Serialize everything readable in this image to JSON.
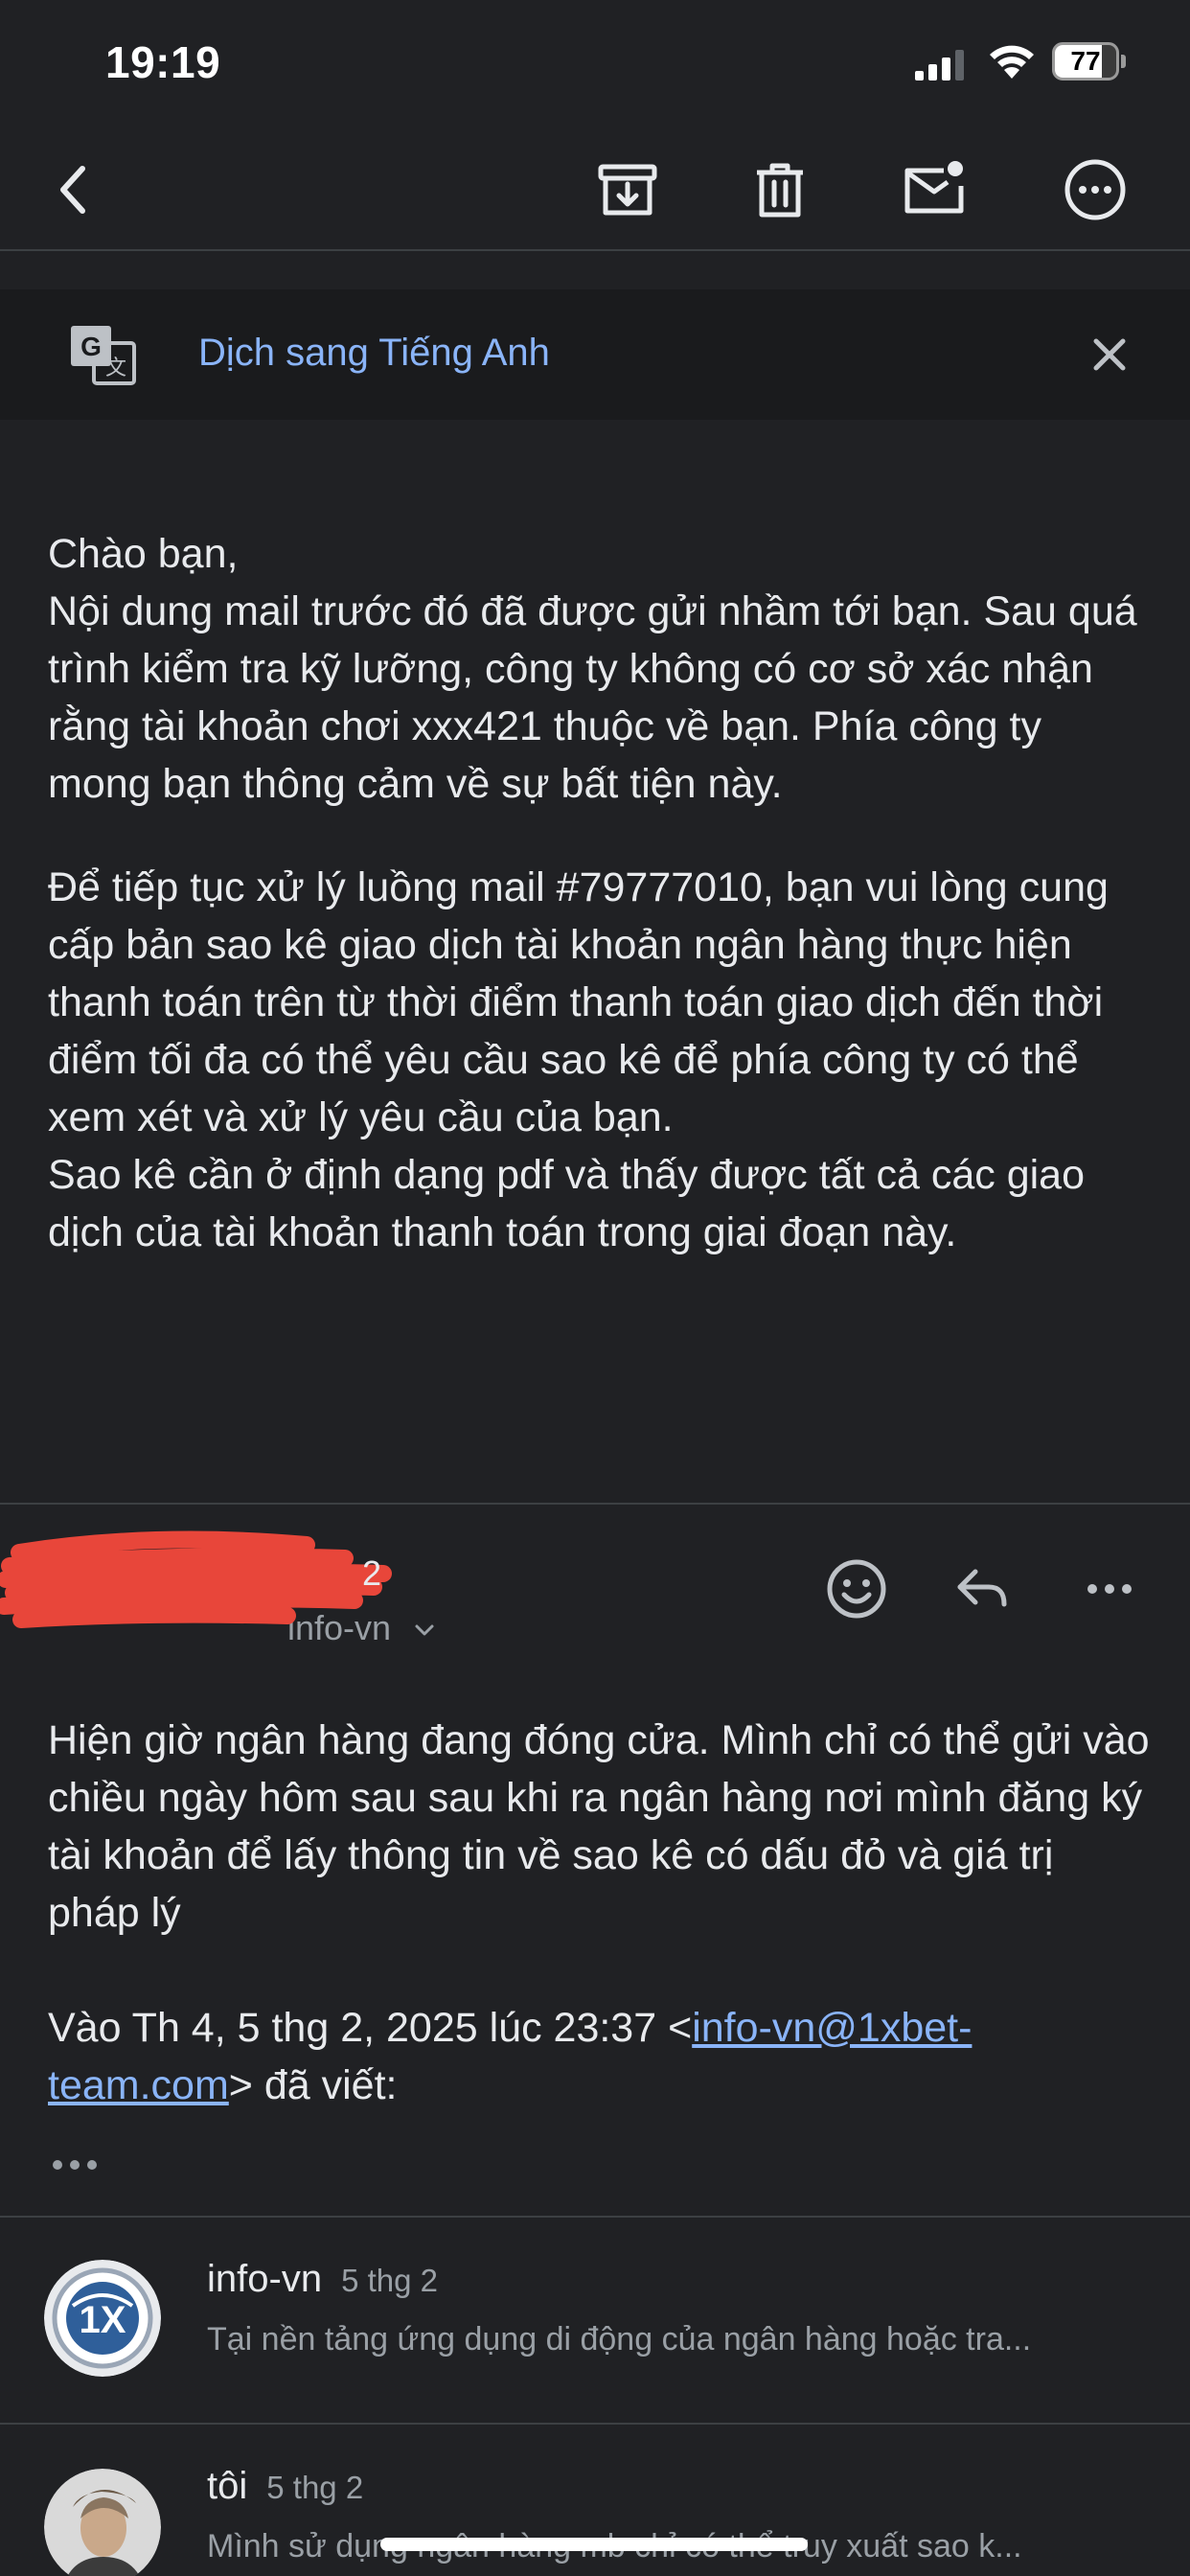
{
  "status_bar": {
    "time": "19:19",
    "battery_level": "77",
    "battery_fraction": 0.77
  },
  "toolbar": {
    "back_icon": "chevron-left-icon",
    "archive_icon": "archive-icon",
    "delete_icon": "trash-icon",
    "mark_unread_icon": "mail-unread-icon",
    "more_icon": "more-horizontal-icon"
  },
  "translate_bar": {
    "label": "Dịch sang Tiếng Anh",
    "icon": "translate-icon",
    "close_icon": "close-icon"
  },
  "message_1": {
    "paragraphs": [
      [
        "Chào bạn,",
        "Nội dung mail trước đó đã được gửi nhầm tới bạn. Sau quá trình kiểm tra kỹ lưỡng, công ty không có cơ sở xác nhận rằng tài khoản chơi xxx421 thuộc về bạn. Phía công ty mong bạn thông cảm về sự bất tiện này."
      ],
      [
        "Để tiếp tục xử lý luồng mail #79777010, bạn vui lòng cung cấp bản sao kê giao dịch tài khoản ngân hàng thực hiện thanh toán trên từ thời điểm thanh toán giao dịch đến thời điểm tối đa có thể yêu cầu sao kê để phía công ty có thể xem xét và xử lý yêu cầu của bạn.",
        "Sao kê cần ở định dạng pdf và thấy được tất cả các giao dịch của tài khoản thanh toán trong giai đoạn này."
      ]
    ]
  },
  "message_2": {
    "sender_detail": "info-vn",
    "action_icons": [
      "emoji-reaction-icon",
      "reply-icon",
      "more-horizontal-icon"
    ],
    "body": "Hiện giờ ngân hàng đang đóng cửa. Mình chỉ có thể gửi vào chiều ngày hôm sau sau khi ra ngân hàng nơi mình đăng ký tài khoản để lấy thông tin về sao kê có dấu đỏ và giá trị pháp lý",
    "quote_prefix": "Vào Th 4, 5 thg 2, 2025 lúc 23:37 <",
    "quote_link": "info-vn@1xbet-team.com",
    "quote_suffix": "> đã viết:",
    "show_quoted_icon": "ellipsis-icon"
  },
  "thread": [
    {
      "name": "info-vn",
      "date": "5 thg 2",
      "snippet": "Tại nền tảng ứng dụng di động của ngân hàng hoặc tra..."
    },
    {
      "name": "tôi",
      "date": "5 thg 2",
      "snippet": "Mình sử dụng ngân hàng mb chỉ có thể truy xuất sao k..."
    }
  ],
  "colors": {
    "background": "#202124",
    "link": "#8ab4f8",
    "redaction": "#e8463a"
  }
}
